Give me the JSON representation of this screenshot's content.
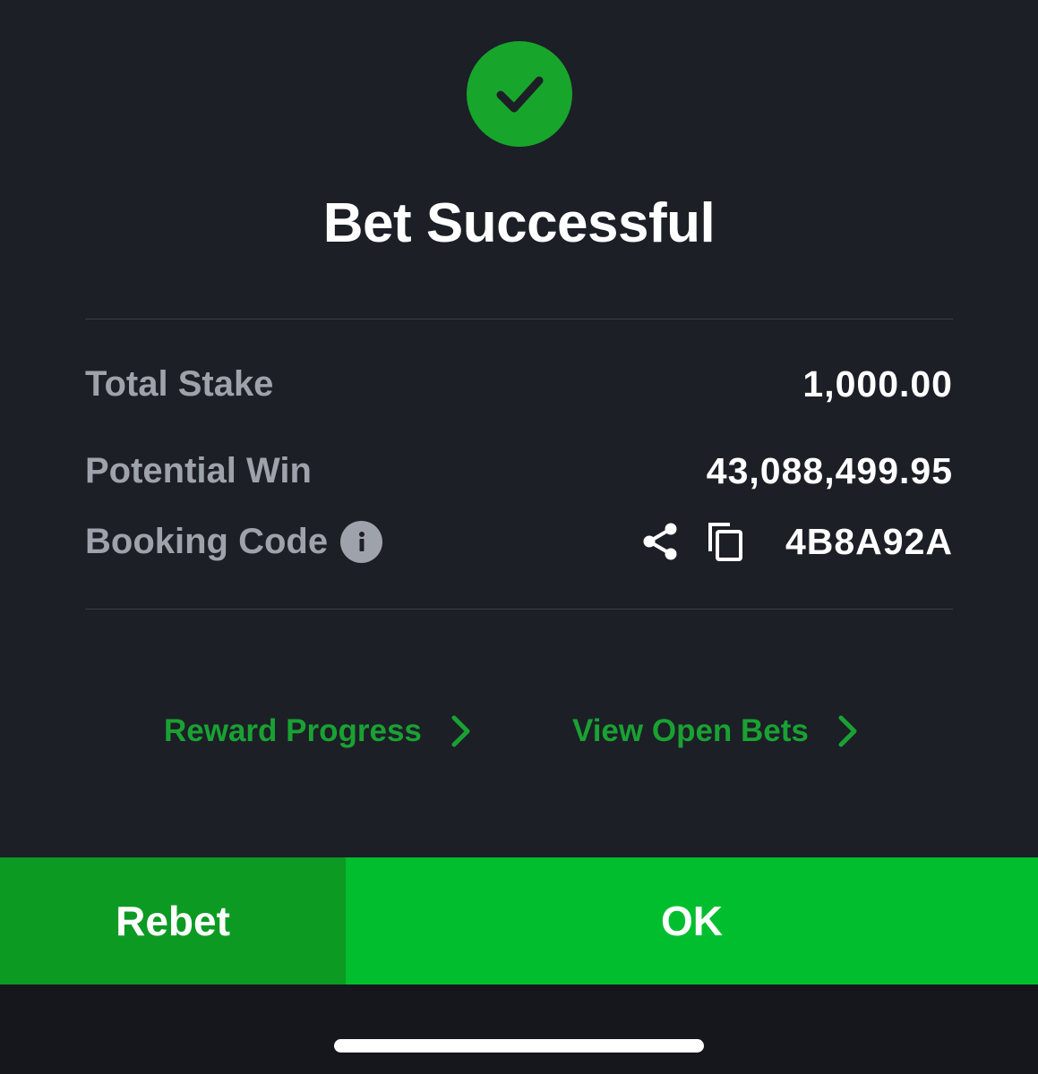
{
  "header": {
    "status_icon": "check-circle-icon",
    "title": "Bet Successful"
  },
  "details": {
    "total_stake": {
      "label": "Total Stake",
      "value": "1,000.00"
    },
    "potential_win": {
      "label": "Potential Win",
      "value": "43,088,499.95"
    },
    "booking_code": {
      "label": "Booking Code",
      "info_icon": "info-icon",
      "share_icon": "share-icon",
      "copy_icon": "copy-icon",
      "value": "4B8A92A"
    }
  },
  "links": {
    "reward_progress": "Reward Progress",
    "view_open_bets": "View Open Bets"
  },
  "buttons": {
    "rebet": "Rebet",
    "ok": "OK"
  },
  "colors": {
    "background": "#1c1f26",
    "success_green": "#18a52c",
    "link_green": "#1aa133",
    "rebet_green": "#0c9a23",
    "ok_green": "#00be2e",
    "label_gray": "#9ea2ab"
  }
}
